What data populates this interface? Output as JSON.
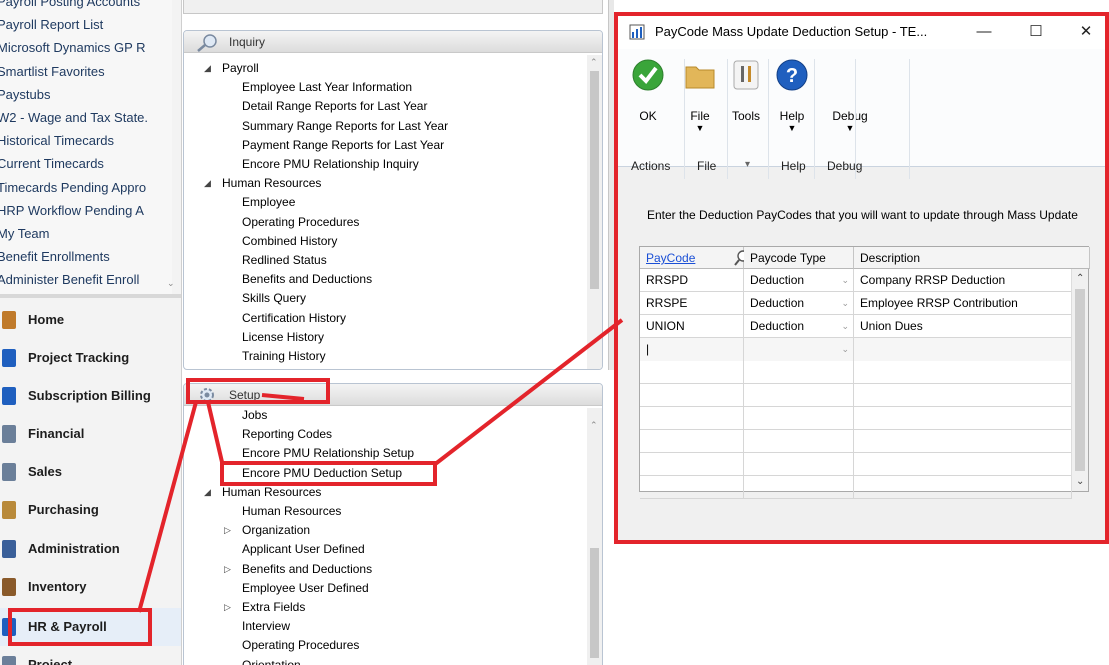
{
  "left_nav": {
    "links": [
      "Payroll Posting Accounts",
      "Payroll Report List",
      "Microsoft Dynamics GP R",
      "Smartlist Favorites",
      "Paystubs",
      "W2 - Wage and Tax State.",
      "Historical Timecards",
      "Current Timecards",
      "Timecards Pending Appro",
      "HRP Workflow Pending A",
      "My Team",
      "Benefit Enrollments",
      "Administer Benefit Enroll"
    ],
    "modules": [
      {
        "label": "Home",
        "icon": "home-icon",
        "active": false
      },
      {
        "label": "Project Tracking",
        "icon": "project-tracking-icon",
        "active": false
      },
      {
        "label": "Subscription Billing",
        "icon": "subscription-billing-icon",
        "active": false
      },
      {
        "label": "Financial",
        "icon": "financial-icon",
        "active": false
      },
      {
        "label": "Sales",
        "icon": "sales-icon",
        "active": false
      },
      {
        "label": "Purchasing",
        "icon": "purchasing-icon",
        "active": false
      },
      {
        "label": "Administration",
        "icon": "administration-icon",
        "active": false
      },
      {
        "label": "Inventory",
        "icon": "inventory-icon",
        "active": false
      },
      {
        "label": "HR & Payroll",
        "icon": "hr-payroll-icon",
        "active": true
      },
      {
        "label": "Project",
        "icon": "project-icon",
        "active": false
      }
    ]
  },
  "inquiry": {
    "title": "Inquiry",
    "items": [
      {
        "text": "Payroll",
        "level": 0,
        "arrow": "expanded"
      },
      {
        "text": "Employee Last Year Information",
        "level": 1
      },
      {
        "text": "Detail Range Reports for  Last Year",
        "level": 1
      },
      {
        "text": "Summary Range Reports for Last Year",
        "level": 1
      },
      {
        "text": "Payment Range Reports for Last Year",
        "level": 1
      },
      {
        "text": "Encore PMU Relationship Inquiry",
        "level": 1
      },
      {
        "text": "Human Resources",
        "level": 0,
        "arrow": "expanded"
      },
      {
        "text": "Employee",
        "level": 1
      },
      {
        "text": "Operating Procedures",
        "level": 1
      },
      {
        "text": "Combined History",
        "level": 1
      },
      {
        "text": "Redlined Status",
        "level": 1
      },
      {
        "text": "Benefits and Deductions",
        "level": 1
      },
      {
        "text": "Skills Query",
        "level": 1
      },
      {
        "text": "Certification History",
        "level": 1
      },
      {
        "text": "License History",
        "level": 1
      },
      {
        "text": "Training History",
        "level": 1
      }
    ]
  },
  "setup": {
    "title": "Setup",
    "items": [
      {
        "text": "Jobs",
        "level": 1
      },
      {
        "text": "Reporting Codes",
        "level": 1
      },
      {
        "text": "Encore PMU Relationship Setup",
        "level": 1
      },
      {
        "text": "Encore PMU Deduction Setup",
        "level": 1
      },
      {
        "text": "Human Resources",
        "level": 0,
        "arrow": "expanded"
      },
      {
        "text": "Human Resources",
        "level": 1
      },
      {
        "text": "Organization",
        "level": 1,
        "arrow": "collapsed"
      },
      {
        "text": "Applicant User Defined",
        "level": 1
      },
      {
        "text": "Benefits and Deductions",
        "level": 1,
        "arrow": "collapsed"
      },
      {
        "text": "Employee User Defined",
        "level": 1
      },
      {
        "text": "Extra Fields",
        "level": 1,
        "arrow": "collapsed"
      },
      {
        "text": "Interview",
        "level": 1
      },
      {
        "text": "Operating Procedures",
        "level": 1
      },
      {
        "text": "Orientation",
        "level": 1
      }
    ]
  },
  "window": {
    "title": "PayCode Mass Update Deduction Setup  -  TE...",
    "controls": {
      "minimize": "—",
      "maximize": "☐",
      "close": "✕"
    },
    "ribbon": {
      "buttons": [
        {
          "label": "OK",
          "icon": "ok-checkmark-icon",
          "dropdown": false
        },
        {
          "label": "File",
          "icon": "folder-icon",
          "dropdown": true
        },
        {
          "label": "Tools",
          "icon": "tools-icon",
          "dropdown": false
        },
        {
          "label": "Help",
          "icon": "help-icon",
          "dropdown": true
        },
        {
          "label": "Debug",
          "icon": "debug-icon",
          "dropdown": true
        }
      ],
      "groups": [
        "Actions",
        "File",
        "▾",
        "Help",
        "Debug"
      ]
    },
    "instruction": "Enter the Deduction PayCodes that you will want to update through Mass Update",
    "grid": {
      "headers": {
        "paycode": "PayCode",
        "type": "Paycode Type",
        "description": "Description"
      },
      "rows": [
        {
          "paycode": "RRSPD",
          "type": "Deduction",
          "description": "Company RRSP Deduction"
        },
        {
          "paycode": "RRSPE",
          "type": "Deduction",
          "description": "Employee RRSP Contribution"
        },
        {
          "paycode": "UNION",
          "type": "Deduction",
          "description": "Union Dues"
        },
        {
          "paycode": "|",
          "type": "",
          "description": ""
        }
      ],
      "empty_rows": 6
    }
  },
  "colors": {
    "annotation_red": "#e3242b",
    "link_blue": "#1a4fd6",
    "ok_green": "#3aa53a",
    "help_blue": "#1f5fbf"
  }
}
